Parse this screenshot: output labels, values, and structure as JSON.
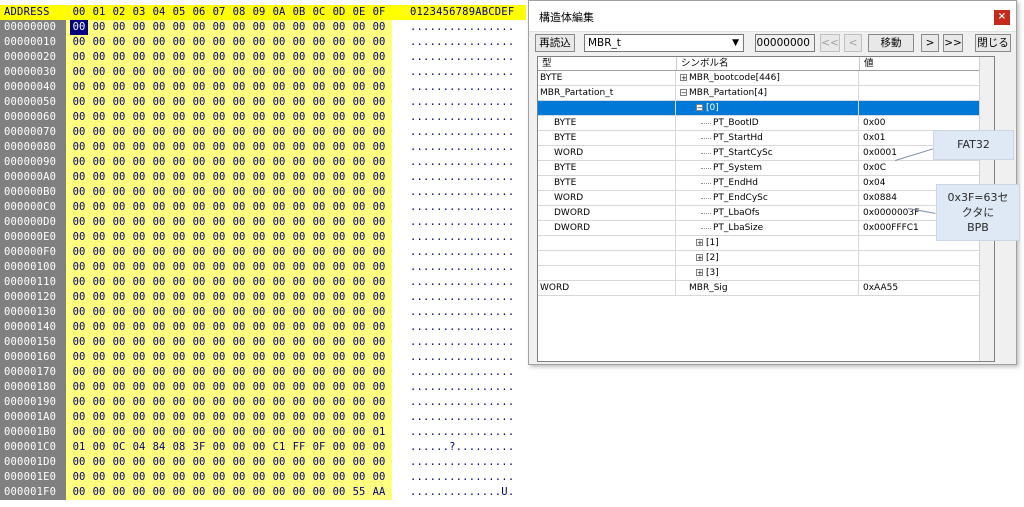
{
  "hex_editor": {
    "header": {
      "address_label": "ADDRESS",
      "columns": [
        "00",
        "01",
        "02",
        "03",
        "04",
        "05",
        "06",
        "07",
        "08",
        "09",
        "0A",
        "0B",
        "0C",
        "0D",
        "0E",
        "0F"
      ],
      "ascii_label": "0123456789ABCDEF"
    },
    "rows": [
      {
        "addr": "00000000",
        "bytes": [
          "00",
          "00",
          "00",
          "00",
          "00",
          "00",
          "00",
          "00",
          "00",
          "00",
          "00",
          "00",
          "00",
          "00",
          "00",
          "00"
        ],
        "ascii": "................"
      },
      {
        "addr": "00000010",
        "bytes": [
          "00",
          "00",
          "00",
          "00",
          "00",
          "00",
          "00",
          "00",
          "00",
          "00",
          "00",
          "00",
          "00",
          "00",
          "00",
          "00"
        ],
        "ascii": "................"
      },
      {
        "addr": "00000020",
        "bytes": [
          "00",
          "00",
          "00",
          "00",
          "00",
          "00",
          "00",
          "00",
          "00",
          "00",
          "00",
          "00",
          "00",
          "00",
          "00",
          "00"
        ],
        "ascii": "................"
      },
      {
        "addr": "00000030",
        "bytes": [
          "00",
          "00",
          "00",
          "00",
          "00",
          "00",
          "00",
          "00",
          "00",
          "00",
          "00",
          "00",
          "00",
          "00",
          "00",
          "00"
        ],
        "ascii": "................"
      },
      {
        "addr": "00000040",
        "bytes": [
          "00",
          "00",
          "00",
          "00",
          "00",
          "00",
          "00",
          "00",
          "00",
          "00",
          "00",
          "00",
          "00",
          "00",
          "00",
          "00"
        ],
        "ascii": "................"
      },
      {
        "addr": "00000050",
        "bytes": [
          "00",
          "00",
          "00",
          "00",
          "00",
          "00",
          "00",
          "00",
          "00",
          "00",
          "00",
          "00",
          "00",
          "00",
          "00",
          "00"
        ],
        "ascii": "................"
      },
      {
        "addr": "00000060",
        "bytes": [
          "00",
          "00",
          "00",
          "00",
          "00",
          "00",
          "00",
          "00",
          "00",
          "00",
          "00",
          "00",
          "00",
          "00",
          "00",
          "00"
        ],
        "ascii": "................"
      },
      {
        "addr": "00000070",
        "bytes": [
          "00",
          "00",
          "00",
          "00",
          "00",
          "00",
          "00",
          "00",
          "00",
          "00",
          "00",
          "00",
          "00",
          "00",
          "00",
          "00"
        ],
        "ascii": "................"
      },
      {
        "addr": "00000080",
        "bytes": [
          "00",
          "00",
          "00",
          "00",
          "00",
          "00",
          "00",
          "00",
          "00",
          "00",
          "00",
          "00",
          "00",
          "00",
          "00",
          "00"
        ],
        "ascii": "................"
      },
      {
        "addr": "00000090",
        "bytes": [
          "00",
          "00",
          "00",
          "00",
          "00",
          "00",
          "00",
          "00",
          "00",
          "00",
          "00",
          "00",
          "00",
          "00",
          "00",
          "00"
        ],
        "ascii": "................"
      },
      {
        "addr": "000000A0",
        "bytes": [
          "00",
          "00",
          "00",
          "00",
          "00",
          "00",
          "00",
          "00",
          "00",
          "00",
          "00",
          "00",
          "00",
          "00",
          "00",
          "00"
        ],
        "ascii": "................"
      },
      {
        "addr": "000000B0",
        "bytes": [
          "00",
          "00",
          "00",
          "00",
          "00",
          "00",
          "00",
          "00",
          "00",
          "00",
          "00",
          "00",
          "00",
          "00",
          "00",
          "00"
        ],
        "ascii": "................"
      },
      {
        "addr": "000000C0",
        "bytes": [
          "00",
          "00",
          "00",
          "00",
          "00",
          "00",
          "00",
          "00",
          "00",
          "00",
          "00",
          "00",
          "00",
          "00",
          "00",
          "00"
        ],
        "ascii": "................"
      },
      {
        "addr": "000000D0",
        "bytes": [
          "00",
          "00",
          "00",
          "00",
          "00",
          "00",
          "00",
          "00",
          "00",
          "00",
          "00",
          "00",
          "00",
          "00",
          "00",
          "00"
        ],
        "ascii": "................"
      },
      {
        "addr": "000000E0",
        "bytes": [
          "00",
          "00",
          "00",
          "00",
          "00",
          "00",
          "00",
          "00",
          "00",
          "00",
          "00",
          "00",
          "00",
          "00",
          "00",
          "00"
        ],
        "ascii": "................"
      },
      {
        "addr": "000000F0",
        "bytes": [
          "00",
          "00",
          "00",
          "00",
          "00",
          "00",
          "00",
          "00",
          "00",
          "00",
          "00",
          "00",
          "00",
          "00",
          "00",
          "00"
        ],
        "ascii": "................"
      },
      {
        "addr": "00000100",
        "bytes": [
          "00",
          "00",
          "00",
          "00",
          "00",
          "00",
          "00",
          "00",
          "00",
          "00",
          "00",
          "00",
          "00",
          "00",
          "00",
          "00"
        ],
        "ascii": "................"
      },
      {
        "addr": "00000110",
        "bytes": [
          "00",
          "00",
          "00",
          "00",
          "00",
          "00",
          "00",
          "00",
          "00",
          "00",
          "00",
          "00",
          "00",
          "00",
          "00",
          "00"
        ],
        "ascii": "................"
      },
      {
        "addr": "00000120",
        "bytes": [
          "00",
          "00",
          "00",
          "00",
          "00",
          "00",
          "00",
          "00",
          "00",
          "00",
          "00",
          "00",
          "00",
          "00",
          "00",
          "00"
        ],
        "ascii": "................"
      },
      {
        "addr": "00000130",
        "bytes": [
          "00",
          "00",
          "00",
          "00",
          "00",
          "00",
          "00",
          "00",
          "00",
          "00",
          "00",
          "00",
          "00",
          "00",
          "00",
          "00"
        ],
        "ascii": "................"
      },
      {
        "addr": "00000140",
        "bytes": [
          "00",
          "00",
          "00",
          "00",
          "00",
          "00",
          "00",
          "00",
          "00",
          "00",
          "00",
          "00",
          "00",
          "00",
          "00",
          "00"
        ],
        "ascii": "................"
      },
      {
        "addr": "00000150",
        "bytes": [
          "00",
          "00",
          "00",
          "00",
          "00",
          "00",
          "00",
          "00",
          "00",
          "00",
          "00",
          "00",
          "00",
          "00",
          "00",
          "00"
        ],
        "ascii": "................"
      },
      {
        "addr": "00000160",
        "bytes": [
          "00",
          "00",
          "00",
          "00",
          "00",
          "00",
          "00",
          "00",
          "00",
          "00",
          "00",
          "00",
          "00",
          "00",
          "00",
          "00"
        ],
        "ascii": "................"
      },
      {
        "addr": "00000170",
        "bytes": [
          "00",
          "00",
          "00",
          "00",
          "00",
          "00",
          "00",
          "00",
          "00",
          "00",
          "00",
          "00",
          "00",
          "00",
          "00",
          "00"
        ],
        "ascii": "................"
      },
      {
        "addr": "00000180",
        "bytes": [
          "00",
          "00",
          "00",
          "00",
          "00",
          "00",
          "00",
          "00",
          "00",
          "00",
          "00",
          "00",
          "00",
          "00",
          "00",
          "00"
        ],
        "ascii": "................"
      },
      {
        "addr": "00000190",
        "bytes": [
          "00",
          "00",
          "00",
          "00",
          "00",
          "00",
          "00",
          "00",
          "00",
          "00",
          "00",
          "00",
          "00",
          "00",
          "00",
          "00"
        ],
        "ascii": "................"
      },
      {
        "addr": "000001A0",
        "bytes": [
          "00",
          "00",
          "00",
          "00",
          "00",
          "00",
          "00",
          "00",
          "00",
          "00",
          "00",
          "00",
          "00",
          "00",
          "00",
          "00"
        ],
        "ascii": "................"
      },
      {
        "addr": "000001B0",
        "bytes": [
          "00",
          "00",
          "00",
          "00",
          "00",
          "00",
          "00",
          "00",
          "00",
          "00",
          "00",
          "00",
          "00",
          "00",
          "00",
          "01"
        ],
        "ascii": "................"
      },
      {
        "addr": "000001C0",
        "bytes": [
          "01",
          "00",
          "0C",
          "04",
          "84",
          "08",
          "3F",
          "00",
          "00",
          "00",
          "C1",
          "FF",
          "0F",
          "00",
          "00",
          "00"
        ],
        "ascii": "......?........."
      },
      {
        "addr": "000001D0",
        "bytes": [
          "00",
          "00",
          "00",
          "00",
          "00",
          "00",
          "00",
          "00",
          "00",
          "00",
          "00",
          "00",
          "00",
          "00",
          "00",
          "00"
        ],
        "ascii": "................"
      },
      {
        "addr": "000001E0",
        "bytes": [
          "00",
          "00",
          "00",
          "00",
          "00",
          "00",
          "00",
          "00",
          "00",
          "00",
          "00",
          "00",
          "00",
          "00",
          "00",
          "00"
        ],
        "ascii": "................"
      },
      {
        "addr": "000001F0",
        "bytes": [
          "00",
          "00",
          "00",
          "00",
          "00",
          "00",
          "00",
          "00",
          "00",
          "00",
          "00",
          "00",
          "00",
          "00",
          "55",
          "AA"
        ],
        "ascii": "..............U."
      }
    ]
  },
  "structure_window": {
    "title": "構造体編集",
    "close_icon": "×",
    "toolbar": {
      "reload_label": "再読込",
      "type_value": "MBR_t",
      "address_value": "00000000",
      "first_label": "<<",
      "prev_label": "<",
      "move_label": "移動",
      "next_label": ">",
      "last_label": ">>",
      "close_label": "閉じる"
    },
    "grid": {
      "headers": {
        "type": "型",
        "symbol": "シンボル名",
        "value": "値"
      },
      "rows": [
        {
          "type": "BYTE",
          "symbol": "MBR_bootcode[446]",
          "value": "",
          "level": 0,
          "expander": "+"
        },
        {
          "type": "MBR_Partation_t",
          "symbol": "MBR_Partation[4]",
          "value": "",
          "level": 0,
          "expander": "-"
        },
        {
          "type": "",
          "symbol": "[0]",
          "value": "",
          "level": 1,
          "expander": "-",
          "selected": true
        },
        {
          "type": "BYTE",
          "symbol": "PT_BootID",
          "value": "0x00",
          "level": 2,
          "expander": ""
        },
        {
          "type": "BYTE",
          "symbol": "PT_StartHd",
          "value": "0x01",
          "level": 2,
          "expander": ""
        },
        {
          "type": "WORD",
          "symbol": "PT_StartCySc",
          "value": "0x0001",
          "level": 2,
          "expander": ""
        },
        {
          "type": "BYTE",
          "symbol": "PT_System",
          "value": "0x0C",
          "level": 2,
          "expander": ""
        },
        {
          "type": "BYTE",
          "symbol": "PT_EndHd",
          "value": "0x04",
          "level": 2,
          "expander": ""
        },
        {
          "type": "WORD",
          "symbol": "PT_EndCySc",
          "value": "0x0884",
          "level": 2,
          "expander": ""
        },
        {
          "type": "DWORD",
          "symbol": "PT_LbaOfs",
          "value": "0x0000003F",
          "level": 2,
          "expander": ""
        },
        {
          "type": "DWORD",
          "symbol": "PT_LbaSize",
          "value": "0x000FFFC1",
          "level": 2,
          "expander": ""
        },
        {
          "type": "",
          "symbol": "[1]",
          "value": "",
          "level": 1,
          "expander": "+"
        },
        {
          "type": "",
          "symbol": "[2]",
          "value": "",
          "level": 1,
          "expander": "+"
        },
        {
          "type": "",
          "symbol": "[3]",
          "value": "",
          "level": 1,
          "expander": "+"
        },
        {
          "type": "WORD",
          "symbol": "MBR_Sig",
          "value": "0xAA55",
          "level": 0,
          "expander": ""
        }
      ]
    }
  },
  "callouts": {
    "fat32": "FAT32",
    "lba_line1": "0x3F=63セ",
    "lba_line2": "クタに",
    "lba_line3": "BPB"
  }
}
